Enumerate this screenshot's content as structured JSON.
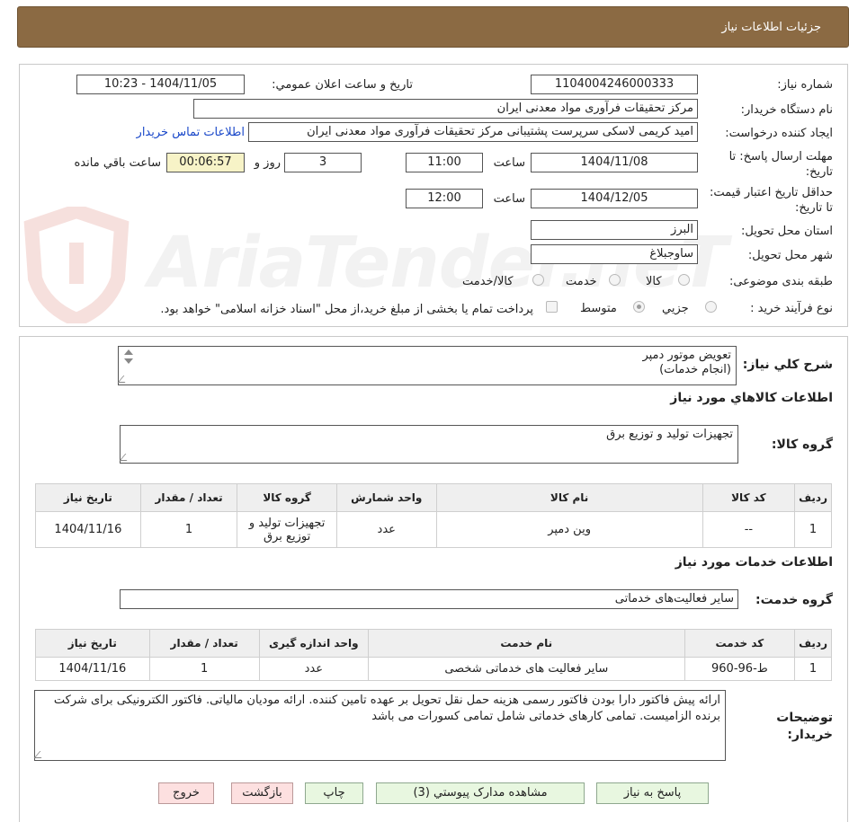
{
  "header": {
    "title": "جزئیات اطلاعات نیاز"
  },
  "watermark": {
    "text": "AriaTender.neT"
  },
  "need_info": {
    "need_number_label": "شماره نیاز:",
    "need_number": "1104004246000333",
    "announce_label": "تاریخ و ساعت اعلان عمومي:",
    "announce_value": "1404/11/05 - 10:23",
    "buyer_org_label": "نام دستگاه خریدار:",
    "buyer_org": "مرکز تحقیقات فرآوری مواد معدنی ایران",
    "requester_label": "ایجاد کننده درخواست:",
    "requester": "امید کریمی لاسکی سرپرست پشتیبانی مرکز تحقیقات فرآوری مواد معدنی ایران",
    "contact_link": "اطلاعات تماس خریدار",
    "deadline_label": "مهلت ارسال پاسخ: تا تاریخ:",
    "deadline_date": "1404/11/08",
    "time_label": "ساعت",
    "deadline_time": "11:00",
    "days": "3",
    "days_label": "روز و",
    "remaining": "00:06:57",
    "remaining_label": "ساعت باقي مانده",
    "price_validity_label": "حداقل تاریخ اعتبار قیمت: تا تاریخ:",
    "price_validity_date": "1404/12/05",
    "price_validity_time": "12:00",
    "province_label": "استان محل تحویل:",
    "province": "البرز",
    "city_label": "شهر محل تحویل:",
    "city": "ساوجبلاغ",
    "category_label": "طبقه بندی موضوعی:",
    "category_options": [
      "کالا",
      "خدمت",
      "کالا/خدمت"
    ],
    "process_label": "نوع فرآیند خرید :",
    "process_options": [
      "جزيي",
      "متوسط"
    ],
    "payment_note": "پرداخت تمام یا بخشی از مبلغ خرید،از محل \"اسناد خزانه اسلامی\" خواهد بود."
  },
  "description": {
    "label": "شرح کلي نیاز:",
    "line1": "تعویض موتور دمپر",
    "line2": "(انجام خدمات)"
  },
  "goods": {
    "section_title": "اطلاعات کالاهاي مورد نیاز",
    "group_label": "گروه کالا:",
    "group_value": "تجهیزات تولید و توزیع برق",
    "columns": [
      "ردیف",
      "کد کالا",
      "نام کالا",
      "واحد شمارش",
      "گروه کالا",
      "تعداد / مقدار",
      "تاریخ نیاز"
    ],
    "rows": [
      [
        "1",
        "--",
        "وین دمپر",
        "عدد",
        "تجهیزات تولید و توزیع برق",
        "1",
        "1404/11/16"
      ]
    ]
  },
  "services": {
    "section_title": "اطلاعات خدمات مورد نیاز",
    "group_label": "گروه خدمت:",
    "group_value": "سایر فعالیت‌های خدماتی",
    "columns": [
      "ردیف",
      "کد خدمت",
      "نام خدمت",
      "واحد اندازه گیری",
      "تعداد / مقدار",
      "تاریخ نیاز"
    ],
    "rows": [
      [
        "1",
        "ط-96-960",
        "سایر فعالیت های خدماتی شخصی",
        "عدد",
        "1",
        "1404/11/16"
      ]
    ]
  },
  "buyer_notes": {
    "label": "توضیحات خریدار:",
    "text": "ارائه پیش فاکتور دارا بودن فاکتور رسمی هزینه حمل نقل تحویل بر عهده تامین کننده. ارائه مودیان مالیاتی. فاکتور الکترونیکی برای شرکت برنده الزامیست. تمامی کارهای خدماتی شامل تمامی کسورات می باشد"
  },
  "buttons": {
    "reply": "پاسخ به نیاز",
    "attachments": "مشاهده مدارک پیوستي (3)",
    "print": "چاپ",
    "back": "بازگشت",
    "exit": "خروج"
  },
  "colors": {
    "header_bg": "#8b6a43",
    "link": "#1a48c9",
    "timer_bg": "#f7f3c7",
    "button_green": "#e8f7e0",
    "button_red": "#fde0e0"
  }
}
